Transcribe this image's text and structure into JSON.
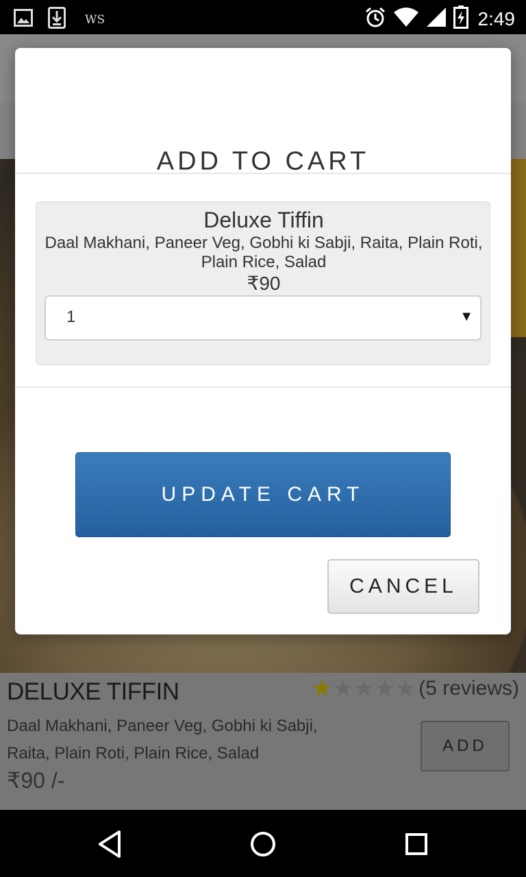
{
  "status_bar": {
    "time": "2:49",
    "carrier_label": "WS",
    "icons": [
      "image-icon",
      "download-icon",
      "alarm-icon",
      "wifi-icon",
      "signal-icon",
      "battery-icon"
    ]
  },
  "background_item": {
    "title": "DELUXE TIFFIN",
    "rating": 1,
    "max_rating": 5,
    "reviews_label": "(5 reviews)",
    "description": "Daal Makhani, Paneer Veg, Gobhi ki Sabji, Raita, Plain Roti, Plain Rice, Salad",
    "price_label": "₹90 /-",
    "add_label": "ADD"
  },
  "modal": {
    "title": "ADD TO CART",
    "product": {
      "name": "Deluxe Tiffin",
      "description": "Daal Makhani, Paneer Veg, Gobhi ki Sabji, Raita, Plain Roti, Plain Rice, Salad",
      "price_label": "₹90"
    },
    "quantity": {
      "selected": "1"
    },
    "update_button_label": "UPDATE CART",
    "cancel_button_label": "CANCEL"
  },
  "nav_bar": {
    "icons": [
      "back-icon",
      "home-icon",
      "recents-icon"
    ]
  },
  "colors": {
    "primary_button": "#2f70b0",
    "rating_star": "#c8b400"
  }
}
